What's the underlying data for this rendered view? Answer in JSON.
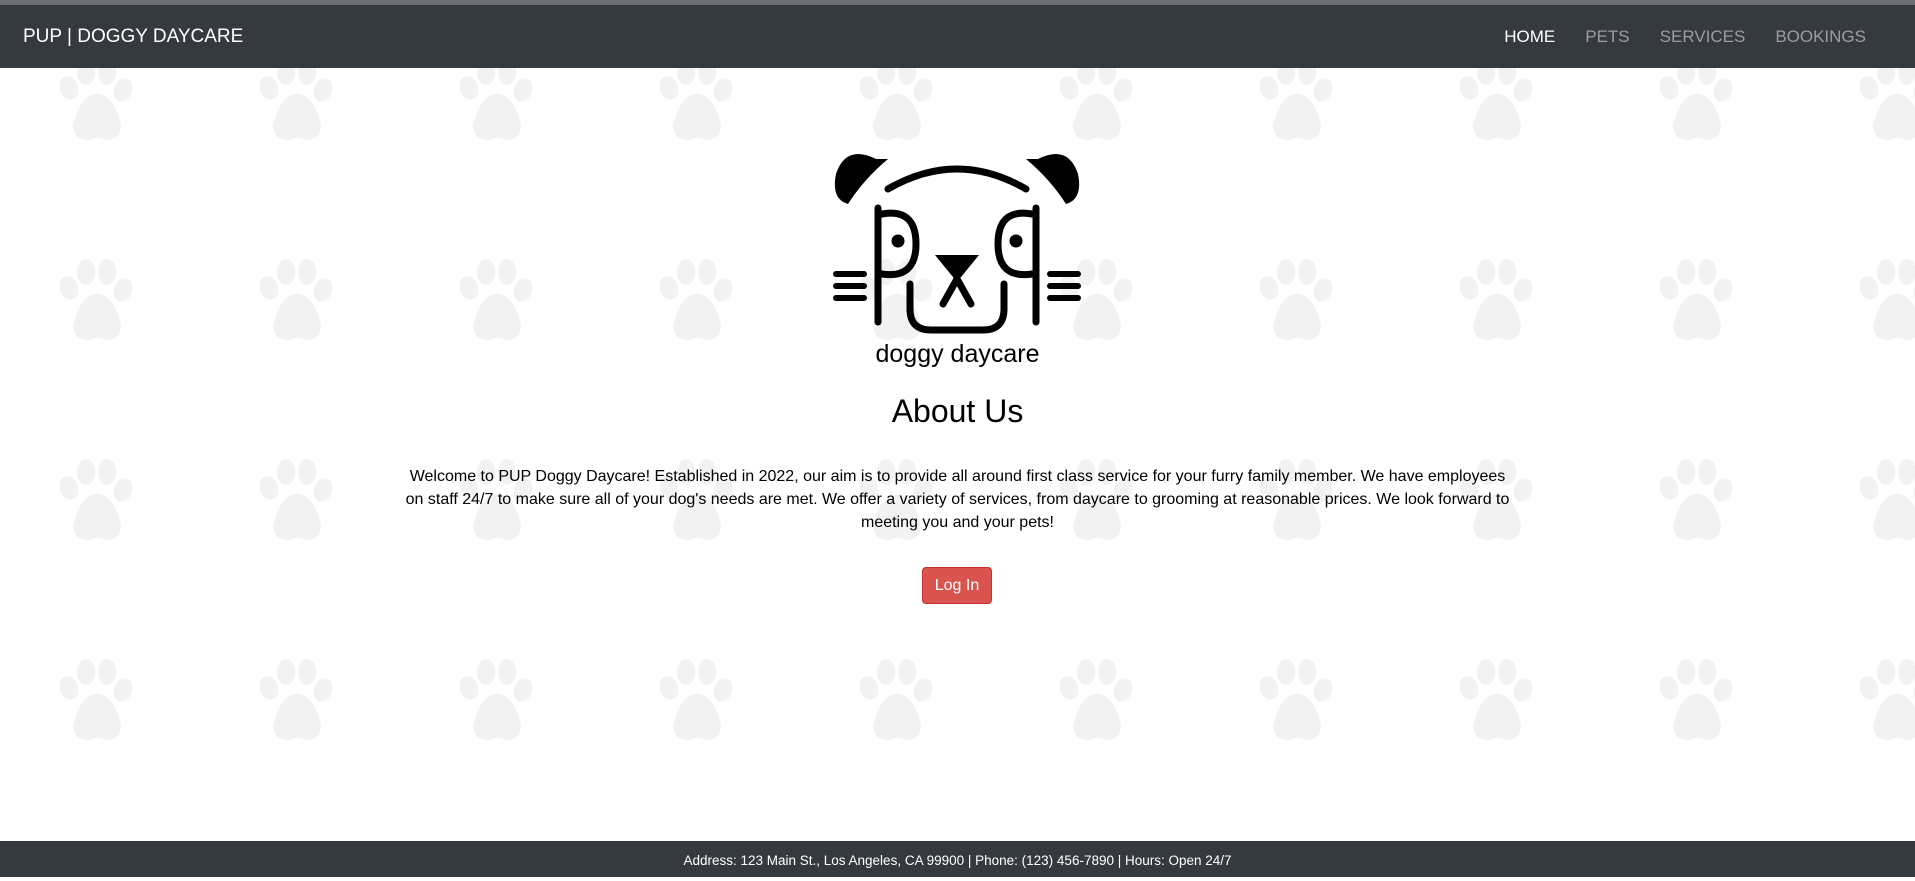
{
  "header": {
    "brand": "PUP | DOGGY DAYCARE",
    "nav": [
      {
        "label": "HOME",
        "active": true
      },
      {
        "label": "PETS",
        "active": false
      },
      {
        "label": "SERVICES",
        "active": false
      },
      {
        "label": "BOOKINGS",
        "active": false
      }
    ]
  },
  "main": {
    "logo_icon": "dog-face-icon",
    "logo_text": "doggy daycare",
    "heading": "About Us",
    "paragraph": "Welcome to PUP Doggy Daycare! Established in 2022, our aim is to provide all around first class service for your furry family member. We have employees on staff 24/7 to make sure all of your dog's needs are met. We offer a variety of services, from daycare to grooming at reasonable prices. We look forward to meeting you and your pets!",
    "login_label": "Log In"
  },
  "footer": {
    "text": "Address: 123 Main St., Los Angeles, CA 99900 | Phone: (123) 456-7890 | Hours: Open 24/7"
  },
  "colors": {
    "navbar": "#343a40",
    "nav_active": "#ffffff",
    "nav_inactive": "#9a9da1",
    "button": "#d9534f",
    "paw_pattern": "#f2f2f2"
  },
  "background_icon": "paw-print-icon"
}
